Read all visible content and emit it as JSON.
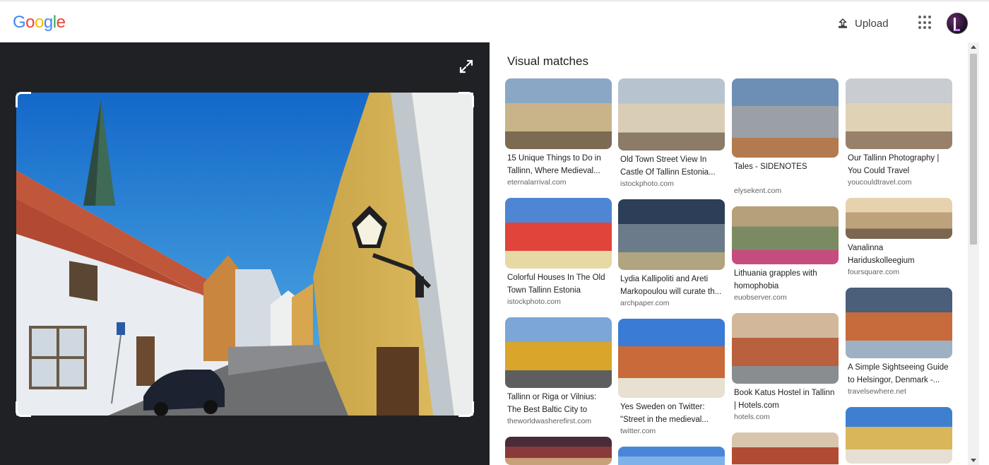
{
  "header": {
    "logo_letters": [
      {
        "char": "G",
        "color": "#4285F4"
      },
      {
        "char": "o",
        "color": "#EA4335"
      },
      {
        "char": "o",
        "color": "#FBBC05"
      },
      {
        "char": "g",
        "color": "#4285F4"
      },
      {
        "char": "l",
        "color": "#34A853"
      },
      {
        "char": "e",
        "color": "#EA4335"
      }
    ],
    "upload_label": "Upload",
    "upload_icon": "upload-icon",
    "apps_icon": "apps-grid-icon",
    "avatar_icon": "account-avatar"
  },
  "viewer": {
    "expand_icon": "expand-icon",
    "background": "#202124"
  },
  "results": {
    "title": "Visual matches",
    "columns": [
      [
        {
          "title": "15 Unique Things to Do in Tallinn, Where Medieval...",
          "source": "eternalarrival.com",
          "thumb_h": 100
        },
        {
          "title": "Colorful Houses In The Old Town Tallinn Estonia Stock...",
          "source": "istockphoto.com",
          "thumb_h": 100
        },
        {
          "title": "Tallinn or Riga or Vilnius: The Best Baltic City to Visit...",
          "source": "theworldwasherefirst.com",
          "thumb_h": 100
        },
        {
          "title": "",
          "source": "",
          "thumb_h": 40
        }
      ],
      [
        {
          "title": "Old Town Street View In Castle Of Tallinn Estonia...",
          "source": "istockphoto.com",
          "thumb_h": 102
        },
        {
          "title": "Lydia Kallipoliti and Areti Markopoulou will curate th...",
          "source": "archpaper.com",
          "thumb_h": 100
        },
        {
          "title": "Yes Sweden on Twitter: \"Street in the medieval...",
          "source": "twitter.com",
          "thumb_h": 112
        },
        {
          "title": "",
          "source": "",
          "thumb_h": 40
        }
      ],
      [
        {
          "title": "Tales - SIDENOTES",
          "source": "elysekent.com",
          "thumb_h": 112
        },
        {
          "title": "Lithuania grapples with homophobia",
          "source": "euobserver.com",
          "thumb_h": 82
        },
        {
          "title": "Book Katus Hostel in Tallinn | Hotels.com",
          "source": "hotels.com",
          "thumb_h": 100
        },
        {
          "title": "",
          "source": "",
          "thumb_h": 60
        }
      ],
      [
        {
          "title": "Our Tallinn Photography | You Could Travel",
          "source": "youcouldtravel.com",
          "thumb_h": 100
        },
        {
          "title": "Vanalinna Hariduskolleegium",
          "source": "foursquare.com",
          "thumb_h": 58
        },
        {
          "title": "A Simple Sightseeing Guide to Helsingor, Denmark -...",
          "source": "travelsewhere.net",
          "thumb_h": 100
        },
        {
          "title": "",
          "source": "",
          "thumb_h": 80
        }
      ]
    ]
  }
}
